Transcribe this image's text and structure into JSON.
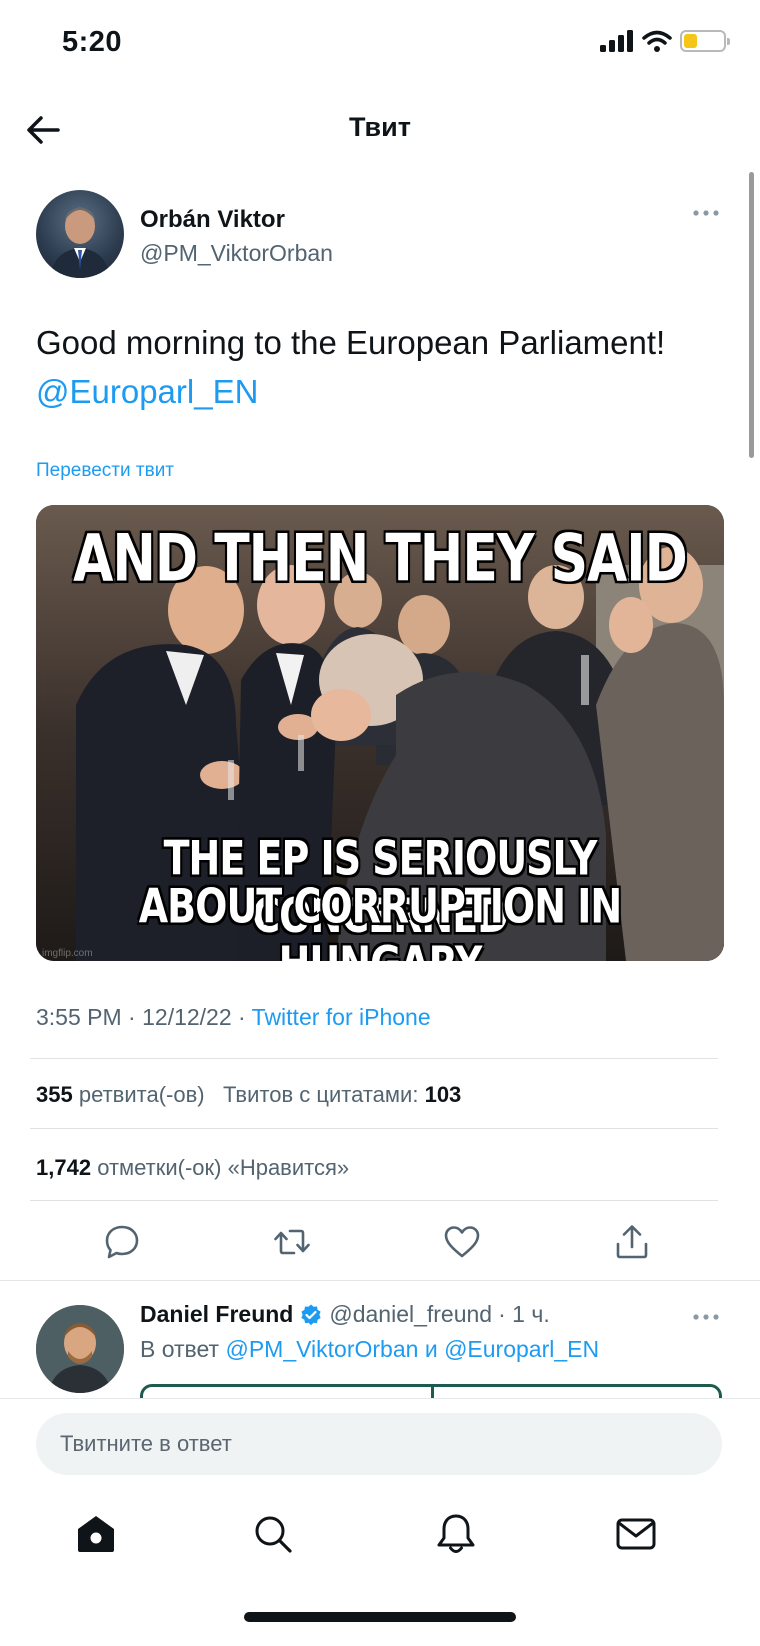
{
  "status_bar": {
    "time": "5:20",
    "battery_level": 0.25,
    "battery_color": "#f5c518"
  },
  "header": {
    "title": "Твит",
    "back_icon": "arrow-left-icon"
  },
  "tweet": {
    "author": {
      "name": "Orbán Viktor",
      "handle": "@PM_ViktorOrban"
    },
    "text_main": "Good morning to the European Parliament!",
    "text_mention": "@Europarl_EN",
    "translate_label": "Перевести твит",
    "image": {
      "caption_top": "AND THEN THEY SAID",
      "caption_bottom_line1": "THE EP IS SERIOUSLY CONCERNED",
      "caption_bottom_line2": "ABOUT CORRUPTION IN HUNGARY",
      "watermark": "imgflip.com"
    },
    "time": "3:55 PM",
    "date": "12/12/22",
    "source": "Twitter for iPhone",
    "retweets_count": "355",
    "retweets_label": "ретвита(-ов)",
    "quotes_label": "Твитов с цитатами:",
    "quotes_count": "103",
    "likes_count": "1,742",
    "likes_label": "отметки(-ок) «Нравится»"
  },
  "actions": [
    "reply-icon",
    "retweet-icon",
    "like-icon",
    "share-icon"
  ],
  "reply": {
    "name": "Daniel Freund",
    "handle": "@daniel_freund",
    "time": "· 1 ч.",
    "reply_to_prefix": "В ответ",
    "reply_to_user1": "@PM_ViktorOrban",
    "reply_to_conj": "и",
    "reply_to_user2": "@Europarl_EN"
  },
  "composer": {
    "placeholder": "Твитните в ответ"
  },
  "bottom_nav": [
    "home-icon",
    "search-icon",
    "notifications-icon",
    "messages-icon"
  ],
  "colors": {
    "accent": "#1d9bf0",
    "text": "#0f1419",
    "secondary_text": "#536471"
  }
}
